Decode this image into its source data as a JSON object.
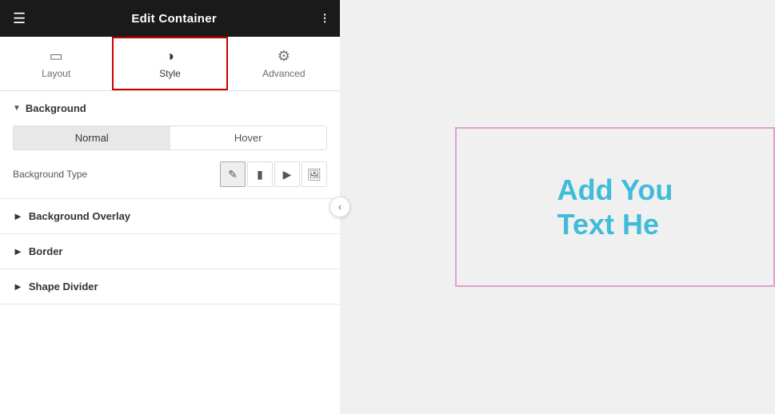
{
  "header": {
    "title": "Edit Container",
    "hamburger": "☰",
    "grid": "⊞"
  },
  "tabs": [
    {
      "id": "layout",
      "label": "Layout",
      "icon": "⊡",
      "active": false
    },
    {
      "id": "style",
      "label": "Style",
      "icon": "◑",
      "active": true
    },
    {
      "id": "advanced",
      "label": "Advanced",
      "icon": "⚙",
      "active": false
    }
  ],
  "background": {
    "section_label": "Background",
    "toggle": {
      "normal_label": "Normal",
      "hover_label": "Hover",
      "active": "normal"
    },
    "background_type_label": "Background Type",
    "type_icons": [
      {
        "id": "none",
        "icon": "✏",
        "active": true
      },
      {
        "id": "classic",
        "icon": "▬",
        "active": false
      },
      {
        "id": "video",
        "icon": "▶",
        "active": false
      },
      {
        "id": "slideshow",
        "icon": "⊞",
        "active": false
      }
    ]
  },
  "sections": [
    {
      "id": "background-overlay",
      "label": "Background Overlay"
    },
    {
      "id": "border",
      "label": "Border"
    },
    {
      "id": "shape-divider",
      "label": "Shape Divider"
    }
  ],
  "canvas": {
    "text_line1": "Add You",
    "text_line2": "Text He"
  }
}
